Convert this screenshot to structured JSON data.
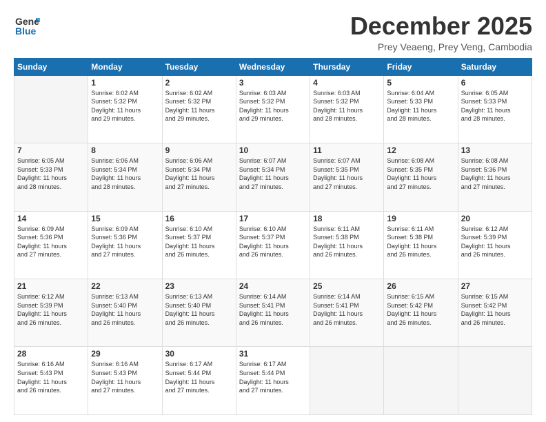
{
  "logo": {
    "line1": "General",
    "line2": "Blue"
  },
  "title": "December 2025",
  "subtitle": "Prey Veaeng, Prey Veng, Cambodia",
  "days_header": [
    "Sunday",
    "Monday",
    "Tuesday",
    "Wednesday",
    "Thursday",
    "Friday",
    "Saturday"
  ],
  "weeks": [
    [
      {
        "day": "",
        "info": ""
      },
      {
        "day": "1",
        "info": "Sunrise: 6:02 AM\nSunset: 5:32 PM\nDaylight: 11 hours\nand 29 minutes."
      },
      {
        "day": "2",
        "info": "Sunrise: 6:02 AM\nSunset: 5:32 PM\nDaylight: 11 hours\nand 29 minutes."
      },
      {
        "day": "3",
        "info": "Sunrise: 6:03 AM\nSunset: 5:32 PM\nDaylight: 11 hours\nand 29 minutes."
      },
      {
        "day": "4",
        "info": "Sunrise: 6:03 AM\nSunset: 5:32 PM\nDaylight: 11 hours\nand 28 minutes."
      },
      {
        "day": "5",
        "info": "Sunrise: 6:04 AM\nSunset: 5:33 PM\nDaylight: 11 hours\nand 28 minutes."
      },
      {
        "day": "6",
        "info": "Sunrise: 6:05 AM\nSunset: 5:33 PM\nDaylight: 11 hours\nand 28 minutes."
      }
    ],
    [
      {
        "day": "7",
        "info": "Sunrise: 6:05 AM\nSunset: 5:33 PM\nDaylight: 11 hours\nand 28 minutes."
      },
      {
        "day": "8",
        "info": "Sunrise: 6:06 AM\nSunset: 5:34 PM\nDaylight: 11 hours\nand 28 minutes."
      },
      {
        "day": "9",
        "info": "Sunrise: 6:06 AM\nSunset: 5:34 PM\nDaylight: 11 hours\nand 27 minutes."
      },
      {
        "day": "10",
        "info": "Sunrise: 6:07 AM\nSunset: 5:34 PM\nDaylight: 11 hours\nand 27 minutes."
      },
      {
        "day": "11",
        "info": "Sunrise: 6:07 AM\nSunset: 5:35 PM\nDaylight: 11 hours\nand 27 minutes."
      },
      {
        "day": "12",
        "info": "Sunrise: 6:08 AM\nSunset: 5:35 PM\nDaylight: 11 hours\nand 27 minutes."
      },
      {
        "day": "13",
        "info": "Sunrise: 6:08 AM\nSunset: 5:36 PM\nDaylight: 11 hours\nand 27 minutes."
      }
    ],
    [
      {
        "day": "14",
        "info": "Sunrise: 6:09 AM\nSunset: 5:36 PM\nDaylight: 11 hours\nand 27 minutes."
      },
      {
        "day": "15",
        "info": "Sunrise: 6:09 AM\nSunset: 5:36 PM\nDaylight: 11 hours\nand 27 minutes."
      },
      {
        "day": "16",
        "info": "Sunrise: 6:10 AM\nSunset: 5:37 PM\nDaylight: 11 hours\nand 26 minutes."
      },
      {
        "day": "17",
        "info": "Sunrise: 6:10 AM\nSunset: 5:37 PM\nDaylight: 11 hours\nand 26 minutes."
      },
      {
        "day": "18",
        "info": "Sunrise: 6:11 AM\nSunset: 5:38 PM\nDaylight: 11 hours\nand 26 minutes."
      },
      {
        "day": "19",
        "info": "Sunrise: 6:11 AM\nSunset: 5:38 PM\nDaylight: 11 hours\nand 26 minutes."
      },
      {
        "day": "20",
        "info": "Sunrise: 6:12 AM\nSunset: 5:39 PM\nDaylight: 11 hours\nand 26 minutes."
      }
    ],
    [
      {
        "day": "21",
        "info": "Sunrise: 6:12 AM\nSunset: 5:39 PM\nDaylight: 11 hours\nand 26 minutes."
      },
      {
        "day": "22",
        "info": "Sunrise: 6:13 AM\nSunset: 5:40 PM\nDaylight: 11 hours\nand 26 minutes."
      },
      {
        "day": "23",
        "info": "Sunrise: 6:13 AM\nSunset: 5:40 PM\nDaylight: 11 hours\nand 26 minutes."
      },
      {
        "day": "24",
        "info": "Sunrise: 6:14 AM\nSunset: 5:41 PM\nDaylight: 11 hours\nand 26 minutes."
      },
      {
        "day": "25",
        "info": "Sunrise: 6:14 AM\nSunset: 5:41 PM\nDaylight: 11 hours\nand 26 minutes."
      },
      {
        "day": "26",
        "info": "Sunrise: 6:15 AM\nSunset: 5:42 PM\nDaylight: 11 hours\nand 26 minutes."
      },
      {
        "day": "27",
        "info": "Sunrise: 6:15 AM\nSunset: 5:42 PM\nDaylight: 11 hours\nand 26 minutes."
      }
    ],
    [
      {
        "day": "28",
        "info": "Sunrise: 6:16 AM\nSunset: 5:43 PM\nDaylight: 11 hours\nand 26 minutes."
      },
      {
        "day": "29",
        "info": "Sunrise: 6:16 AM\nSunset: 5:43 PM\nDaylight: 11 hours\nand 27 minutes."
      },
      {
        "day": "30",
        "info": "Sunrise: 6:17 AM\nSunset: 5:44 PM\nDaylight: 11 hours\nand 27 minutes."
      },
      {
        "day": "31",
        "info": "Sunrise: 6:17 AM\nSunset: 5:44 PM\nDaylight: 11 hours\nand 27 minutes."
      },
      {
        "day": "",
        "info": ""
      },
      {
        "day": "",
        "info": ""
      },
      {
        "day": "",
        "info": ""
      }
    ]
  ]
}
